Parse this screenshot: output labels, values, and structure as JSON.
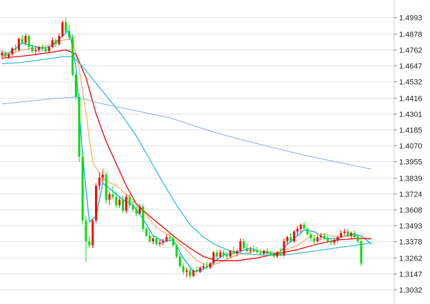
{
  "chart_data": {
    "type": "candlestick",
    "title": "",
    "xlabel": "",
    "ylabel": "",
    "ylim": [
      1.3032,
      1.505
    ],
    "y_axis_position": "right",
    "grid": true,
    "legend": "none",
    "y_ticks": [
      "1.4993",
      "1.4878",
      "1.4762",
      "1.4647",
      "1.4532",
      "1.4416",
      "1.4301",
      "1.4185",
      "1.4070",
      "1.3955",
      "1.3839",
      "1.3724",
      "1.3608",
      "1.3493",
      "1.3378",
      "1.3262",
      "1.3147",
      "1.3032"
    ],
    "colors": {
      "up": "#ff0000",
      "down": "#00dd00",
      "ma_short": "#00aaff",
      "ma_orange": "#ffaa66",
      "ma_red": "#e00000",
      "ma_cyan": "#33bbcc",
      "ma_long": "#88aadd",
      "grid": "#e2e2e2"
    },
    "candles": [
      [
        1.472,
        1.476,
        1.469,
        1.474
      ],
      [
        1.474,
        1.475,
        1.47,
        1.471
      ],
      [
        1.471,
        1.474,
        1.4695,
        1.473
      ],
      [
        1.473,
        1.478,
        1.4715,
        1.477
      ],
      [
        1.477,
        1.48,
        1.475,
        1.476
      ],
      [
        1.476,
        1.485,
        1.475,
        1.484
      ],
      [
        1.484,
        1.487,
        1.48,
        1.481
      ],
      [
        1.481,
        1.488,
        1.479,
        1.486
      ],
      [
        1.486,
        1.487,
        1.476,
        1.478
      ],
      [
        1.478,
        1.48,
        1.474,
        1.475
      ],
      [
        1.475,
        1.478,
        1.472,
        1.476
      ],
      [
        1.476,
        1.479,
        1.474,
        1.478
      ],
      [
        1.478,
        1.48,
        1.475,
        1.477
      ],
      [
        1.477,
        1.478,
        1.474,
        1.475
      ],
      [
        1.475,
        1.479,
        1.474,
        1.478
      ],
      [
        1.478,
        1.485,
        1.477,
        1.483
      ],
      [
        1.483,
        1.484,
        1.478,
        1.48
      ],
      [
        1.48,
        1.488,
        1.479,
        1.486
      ],
      [
        1.486,
        1.497,
        1.485,
        1.496
      ],
      [
        1.496,
        1.499,
        1.488,
        1.489
      ],
      [
        1.489,
        1.494,
        1.483,
        1.485
      ],
      [
        1.485,
        1.487,
        1.457,
        1.458
      ],
      [
        1.458,
        1.46,
        1.44,
        1.442
      ],
      [
        1.442,
        1.445,
        1.395,
        1.399
      ],
      [
        1.399,
        1.402,
        1.35,
        1.353
      ],
      [
        1.353,
        1.356,
        1.323,
        1.338
      ],
      [
        1.338,
        1.342,
        1.333,
        1.335
      ],
      [
        1.335,
        1.354,
        1.333,
        1.353
      ],
      [
        1.353,
        1.38,
        1.351,
        1.378
      ],
      [
        1.378,
        1.388,
        1.375,
        1.384
      ],
      [
        1.384,
        1.39,
        1.38,
        1.386
      ],
      [
        1.386,
        1.388,
        1.365,
        1.368
      ],
      [
        1.368,
        1.374,
        1.364,
        1.372
      ],
      [
        1.372,
        1.378,
        1.368,
        1.37
      ],
      [
        1.37,
        1.374,
        1.362,
        1.364
      ],
      [
        1.364,
        1.37,
        1.362,
        1.368
      ],
      [
        1.368,
        1.371,
        1.358,
        1.36
      ],
      [
        1.36,
        1.372,
        1.358,
        1.37
      ],
      [
        1.37,
        1.372,
        1.362,
        1.364
      ],
      [
        1.364,
        1.367,
        1.359,
        1.361
      ],
      [
        1.361,
        1.364,
        1.356,
        1.358
      ],
      [
        1.358,
        1.365,
        1.357,
        1.363
      ],
      [
        1.363,
        1.365,
        1.345,
        1.347
      ],
      [
        1.347,
        1.348,
        1.341,
        1.342
      ],
      [
        1.342,
        1.345,
        1.337,
        1.338
      ],
      [
        1.338,
        1.342,
        1.336,
        1.34
      ],
      [
        1.34,
        1.342,
        1.335,
        1.336
      ],
      [
        1.336,
        1.339,
        1.334,
        1.337
      ],
      [
        1.337,
        1.34,
        1.335,
        1.338
      ],
      [
        1.338,
        1.343,
        1.337,
        1.341
      ],
      [
        1.341,
        1.344,
        1.338,
        1.34
      ],
      [
        1.34,
        1.342,
        1.334,
        1.335
      ],
      [
        1.335,
        1.336,
        1.326,
        1.327
      ],
      [
        1.327,
        1.329,
        1.319,
        1.32
      ],
      [
        1.32,
        1.322,
        1.314,
        1.316
      ],
      [
        1.316,
        1.319,
        1.312,
        1.317
      ],
      [
        1.317,
        1.32,
        1.311,
        1.313
      ],
      [
        1.313,
        1.318,
        1.312,
        1.317
      ],
      [
        1.317,
        1.32,
        1.315,
        1.316
      ],
      [
        1.316,
        1.32,
        1.315,
        1.319
      ],
      [
        1.319,
        1.322,
        1.317,
        1.32
      ],
      [
        1.32,
        1.323,
        1.318,
        1.319
      ],
      [
        1.319,
        1.323,
        1.318,
        1.322
      ],
      [
        1.322,
        1.331,
        1.321,
        1.33
      ],
      [
        1.33,
        1.332,
        1.325,
        1.327
      ],
      [
        1.327,
        1.332,
        1.326,
        1.33
      ],
      [
        1.33,
        1.332,
        1.326,
        1.328
      ],
      [
        1.328,
        1.33,
        1.325,
        1.327
      ],
      [
        1.327,
        1.332,
        1.326,
        1.331
      ],
      [
        1.331,
        1.334,
        1.328,
        1.329
      ],
      [
        1.329,
        1.332,
        1.327,
        1.331
      ],
      [
        1.331,
        1.34,
        1.33,
        1.338
      ],
      [
        1.338,
        1.34,
        1.332,
        1.333
      ],
      [
        1.333,
        1.336,
        1.33,
        1.331
      ],
      [
        1.331,
        1.334,
        1.329,
        1.332
      ],
      [
        1.332,
        1.335,
        1.33,
        1.331
      ],
      [
        1.331,
        1.334,
        1.329,
        1.33
      ],
      [
        1.33,
        1.332,
        1.328,
        1.329
      ],
      [
        1.329,
        1.332,
        1.328,
        1.331
      ],
      [
        1.331,
        1.333,
        1.328,
        1.329
      ],
      [
        1.329,
        1.331,
        1.327,
        1.328
      ],
      [
        1.328,
        1.33,
        1.326,
        1.327
      ],
      [
        1.327,
        1.331,
        1.326,
        1.33
      ],
      [
        1.33,
        1.333,
        1.327,
        1.328
      ],
      [
        1.328,
        1.34,
        1.327,
        1.338
      ],
      [
        1.338,
        1.342,
        1.336,
        1.341
      ],
      [
        1.341,
        1.344,
        1.337,
        1.338
      ],
      [
        1.338,
        1.346,
        1.337,
        1.345
      ],
      [
        1.345,
        1.349,
        1.342,
        1.347
      ],
      [
        1.347,
        1.351,
        1.344,
        1.35
      ],
      [
        1.35,
        1.352,
        1.346,
        1.347
      ],
      [
        1.347,
        1.348,
        1.342,
        1.343
      ],
      [
        1.343,
        1.344,
        1.338,
        1.34
      ],
      [
        1.34,
        1.342,
        1.336,
        1.338
      ],
      [
        1.338,
        1.342,
        1.337,
        1.341
      ],
      [
        1.341,
        1.344,
        1.339,
        1.342
      ],
      [
        1.342,
        1.344,
        1.339,
        1.34
      ],
      [
        1.34,
        1.342,
        1.337,
        1.338
      ],
      [
        1.338,
        1.34,
        1.335,
        1.337
      ],
      [
        1.337,
        1.34,
        1.335,
        1.339
      ],
      [
        1.339,
        1.342,
        1.337,
        1.341
      ],
      [
        1.341,
        1.346,
        1.34,
        1.344
      ],
      [
        1.344,
        1.347,
        1.342,
        1.345
      ],
      [
        1.345,
        1.347,
        1.341,
        1.342
      ],
      [
        1.342,
        1.345,
        1.34,
        1.344
      ],
      [
        1.344,
        1.346,
        1.34,
        1.341
      ],
      [
        1.341,
        1.343,
        1.337,
        1.338
      ],
      [
        1.338,
        1.34,
        1.32,
        1.322
      ]
    ],
    "ma_series": [
      {
        "key": "ma_short",
        "points": [
          [
            0,
            1.472
          ],
          [
            3,
            1.475
          ],
          [
            6,
            1.481
          ],
          [
            9,
            1.479
          ],
          [
            12,
            1.477
          ],
          [
            15,
            1.479
          ],
          [
            18,
            1.486
          ],
          [
            20,
            1.49
          ],
          [
            22,
            1.464
          ],
          [
            24,
            1.4
          ],
          [
            26,
            1.352
          ],
          [
            28,
            1.356
          ],
          [
            30,
            1.38
          ],
          [
            33,
            1.374
          ],
          [
            36,
            1.368
          ],
          [
            39,
            1.364
          ],
          [
            42,
            1.354
          ],
          [
            45,
            1.342
          ],
          [
            48,
            1.338
          ],
          [
            51,
            1.339
          ],
          [
            54,
            1.326
          ],
          [
            57,
            1.316
          ],
          [
            60,
            1.318
          ],
          [
            63,
            1.323
          ],
          [
            66,
            1.328
          ],
          [
            70,
            1.33
          ],
          [
            74,
            1.333
          ],
          [
            78,
            1.33
          ],
          [
            82,
            1.329
          ],
          [
            86,
            1.338
          ],
          [
            90,
            1.346
          ],
          [
            93,
            1.345
          ],
          [
            96,
            1.34
          ],
          [
            100,
            1.34
          ],
          [
            104,
            1.343
          ],
          [
            107,
            1.342
          ],
          [
            110,
            1.336
          ]
        ]
      },
      {
        "key": "ma_orange",
        "points": [
          [
            0,
            1.471
          ],
          [
            6,
            1.476
          ],
          [
            12,
            1.478
          ],
          [
            18,
            1.483
          ],
          [
            21,
            1.484
          ],
          [
            23,
            1.462
          ],
          [
            25,
            1.43
          ],
          [
            27,
            1.395
          ],
          [
            30,
            1.383
          ],
          [
            34,
            1.378
          ],
          [
            38,
            1.37
          ],
          [
            42,
            1.36
          ],
          [
            46,
            1.348
          ],
          [
            50,
            1.342
          ],
          [
            54,
            1.334
          ],
          [
            58,
            1.324
          ],
          [
            62,
            1.32
          ],
          [
            66,
            1.324
          ],
          [
            70,
            1.328
          ],
          [
            76,
            1.331
          ],
          [
            82,
            1.33
          ],
          [
            88,
            1.335
          ],
          [
            92,
            1.342
          ],
          [
            96,
            1.343
          ],
          [
            100,
            1.341
          ],
          [
            105,
            1.342
          ],
          [
            110,
            1.339
          ]
        ]
      },
      {
        "key": "ma_red",
        "points": [
          [
            0,
            1.47
          ],
          [
            8,
            1.472
          ],
          [
            14,
            1.474
          ],
          [
            19,
            1.476
          ],
          [
            22,
            1.473
          ],
          [
            25,
            1.456
          ],
          [
            28,
            1.43
          ],
          [
            31,
            1.41
          ],
          [
            34,
            1.394
          ],
          [
            37,
            1.378
          ],
          [
            40,
            1.365
          ],
          [
            44,
            1.356
          ],
          [
            48,
            1.348
          ],
          [
            52,
            1.34
          ],
          [
            56,
            1.333
          ],
          [
            60,
            1.327
          ],
          [
            64,
            1.324
          ],
          [
            70,
            1.324
          ],
          [
            76,
            1.326
          ],
          [
            82,
            1.329
          ],
          [
            88,
            1.332
          ],
          [
            94,
            1.336
          ],
          [
            100,
            1.339
          ],
          [
            106,
            1.34
          ],
          [
            110,
            1.34
          ]
        ]
      },
      {
        "key": "ma_cyan",
        "points": [
          [
            0,
            1.466
          ],
          [
            6,
            1.467
          ],
          [
            12,
            1.469
          ],
          [
            18,
            1.471
          ],
          [
            21,
            1.471
          ],
          [
            24,
            1.464
          ],
          [
            28,
            1.452
          ],
          [
            32,
            1.44
          ],
          [
            36,
            1.428
          ],
          [
            40,
            1.414
          ],
          [
            44,
            1.397
          ],
          [
            48,
            1.38
          ],
          [
            52,
            1.364
          ],
          [
            56,
            1.35
          ],
          [
            60,
            1.341
          ],
          [
            64,
            1.335
          ],
          [
            68,
            1.331
          ],
          [
            72,
            1.329
          ],
          [
            78,
            1.328
          ],
          [
            84,
            1.328
          ],
          [
            90,
            1.33
          ],
          [
            96,
            1.332
          ],
          [
            102,
            1.334
          ],
          [
            108,
            1.336
          ],
          [
            110,
            1.337
          ]
        ]
      },
      {
        "key": "ma_long",
        "points": [
          [
            0,
            1.437
          ],
          [
            8,
            1.439
          ],
          [
            16,
            1.441
          ],
          [
            22,
            1.442
          ],
          [
            30,
            1.437
          ],
          [
            40,
            1.432
          ],
          [
            50,
            1.427
          ],
          [
            60,
            1.419
          ],
          [
            70,
            1.412
          ],
          [
            80,
            1.406
          ],
          [
            90,
            1.4
          ],
          [
            100,
            1.395
          ],
          [
            110,
            1.39
          ]
        ]
      }
    ]
  }
}
